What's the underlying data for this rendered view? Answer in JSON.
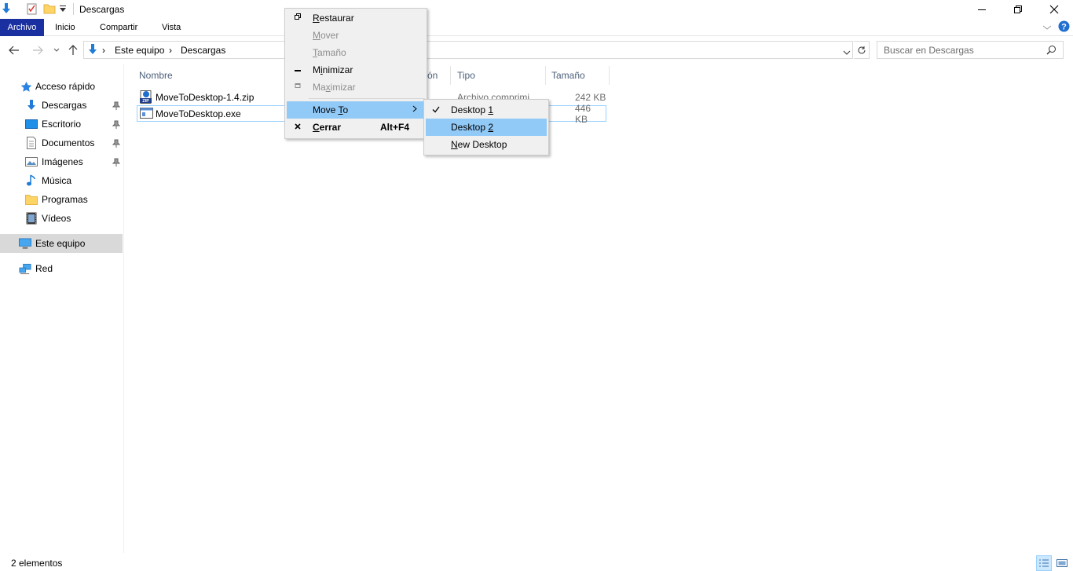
{
  "window": {
    "title": "Descargas"
  },
  "ribbon": {
    "tabs": [
      "Archivo",
      "Inicio",
      "Compartir",
      "Vista"
    ]
  },
  "address": {
    "crumbs": [
      "Este equipo",
      "Descargas"
    ]
  },
  "search": {
    "placeholder": "Buscar en Descargas"
  },
  "nav": {
    "quick_access": "Acceso rápido",
    "items": [
      "Descargas",
      "Escritorio",
      "Documentos",
      "Imágenes",
      "Música",
      "Programas",
      "Vídeos"
    ],
    "this_pc": "Este equipo",
    "network": "Red"
  },
  "columns": {
    "name": "Nombre",
    "date_fragment": "ón",
    "type": "Tipo",
    "size": "Tamaño"
  },
  "files": [
    {
      "name": "MoveToDesktop-1.4.zip",
      "type": "Archivo comprimi",
      "size": "242 KB"
    },
    {
      "name": "MoveToDesktop.exe",
      "type": "",
      "size": "446 KB"
    }
  ],
  "menu": {
    "restore_pre": "",
    "restore_acc": "R",
    "restore_post": "estaurar",
    "move_pre": "",
    "move_acc": "M",
    "move_post": "over",
    "size_pre": "",
    "size_acc": "T",
    "size_post": "amaño",
    "min_pre": "M",
    "min_acc": "i",
    "min_post": "nimizar",
    "max_pre": "Ma",
    "max_acc": "x",
    "max_post": "imizar",
    "moveto_pre": "Move ",
    "moveto_acc": "T",
    "moveto_post": "o",
    "close_pre": "",
    "close_acc": "C",
    "close_post": "errar",
    "close_shortcut": "Alt+F4"
  },
  "submenu": {
    "d1_pre": "Desktop ",
    "d1_acc": "1",
    "d2_pre": "Desktop ",
    "d2_acc": "2",
    "new_acc": "N",
    "new_post": "ew Desktop"
  },
  "status": {
    "count": "2 elementos"
  },
  "colors": {
    "file_tab": "#1a2fa0",
    "menu_highlight": "#91c9f7",
    "selection_border": "#99d1ff"
  }
}
